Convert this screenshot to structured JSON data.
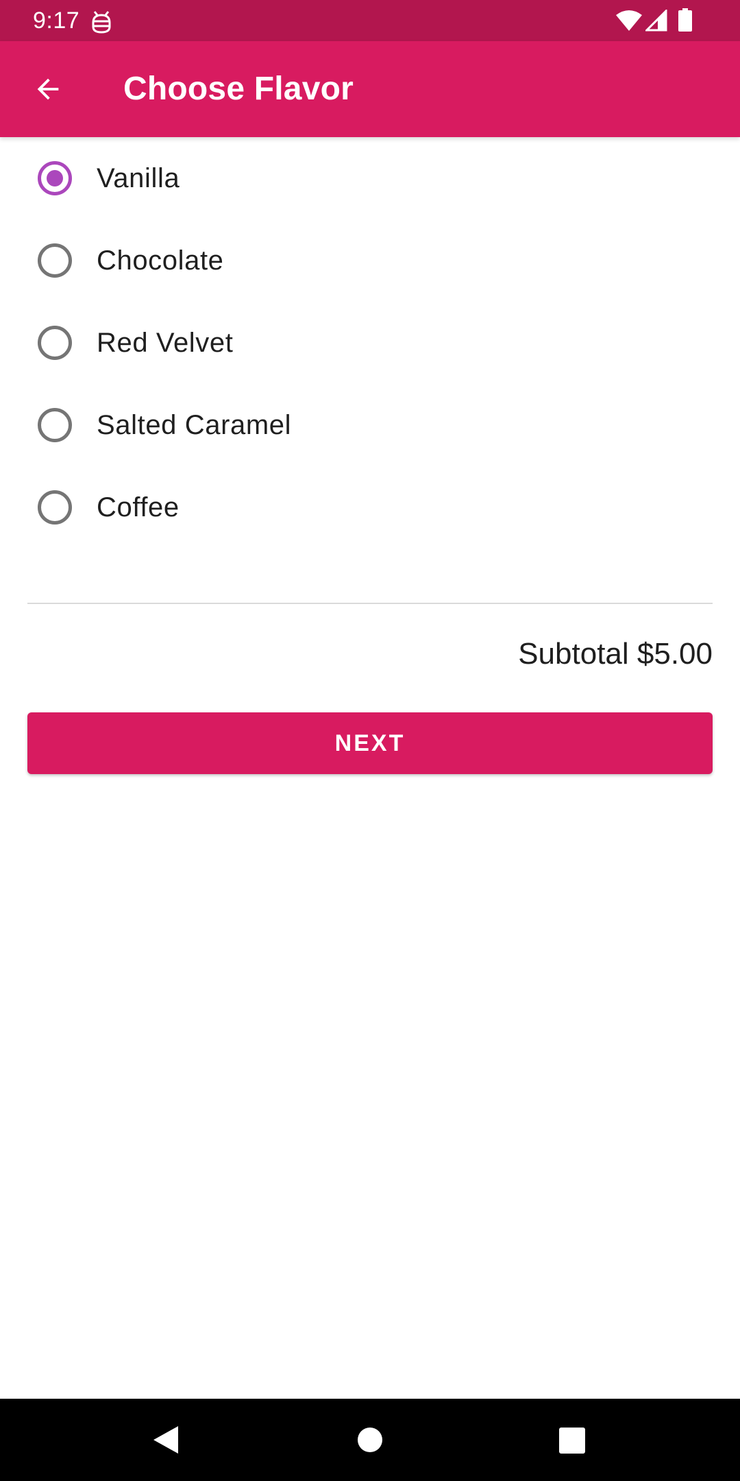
{
  "status_bar": {
    "time": "9:17",
    "app_icon": "debug-android-icon",
    "icons": [
      "wifi-icon",
      "signal-icon",
      "battery-icon"
    ],
    "background_color": "#B2164E"
  },
  "app_bar": {
    "back_icon": "arrow-back-icon",
    "title": "Choose Flavor",
    "background_color": "#D81B60"
  },
  "flavors": {
    "selected": "Vanilla",
    "accent_color": "#AB47BC",
    "options": [
      {
        "label": "Vanilla",
        "checked": true
      },
      {
        "label": "Chocolate",
        "checked": false
      },
      {
        "label": "Red Velvet",
        "checked": false
      },
      {
        "label": "Salted Caramel",
        "checked": false
      },
      {
        "label": "Coffee",
        "checked": false
      }
    ]
  },
  "summary": {
    "subtotal": "Subtotal $5.00"
  },
  "actions": {
    "next_label": "NEXT",
    "button_color": "#D81B60"
  },
  "nav_bar": {
    "buttons": [
      "nav-back-icon",
      "nav-home-icon",
      "nav-recents-icon"
    ]
  }
}
